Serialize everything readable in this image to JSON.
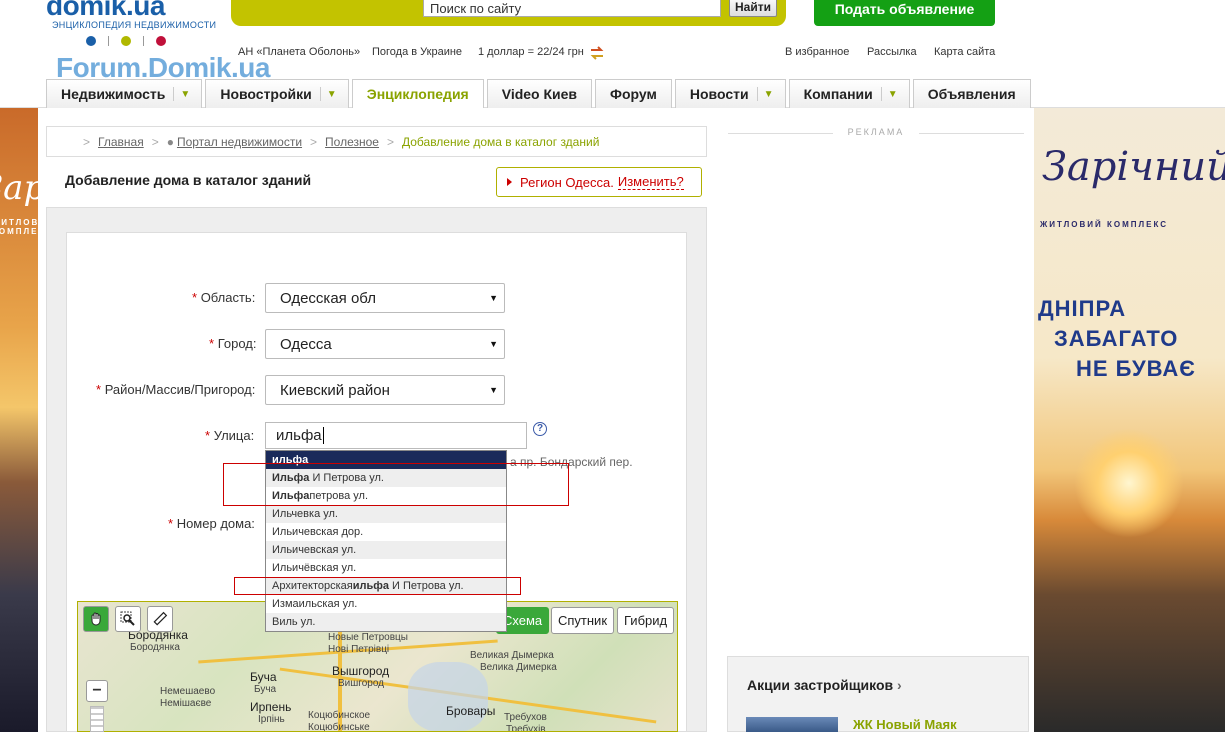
{
  "header": {
    "logo": "domik.ua",
    "logo_sub": "ЭНЦИКЛОПЕДИЯ НЕДВИЖИМОСТИ",
    "watermark": "Forum.Domik.ua",
    "search_placeholder": "Поиск по сайту",
    "search_button": "Найти",
    "post_button": "Подать объявление",
    "info_links": [
      "АН «Планета Оболонь»",
      "Погода в Украине",
      "1 доллар = 22/24 грн"
    ],
    "top_links": [
      "В избранное",
      "Рассылка",
      "Карта сайта"
    ],
    "dot_colors": [
      "#1a5fa8",
      "#b0b800",
      "#c0103a"
    ]
  },
  "nav": {
    "items": [
      {
        "label": "Недвижимость",
        "arrow": true
      },
      {
        "label": "Новостройки",
        "arrow": true
      },
      {
        "label": "Энциклопедия",
        "arrow": false,
        "active": true
      },
      {
        "label": "Video Киев",
        "arrow": false
      },
      {
        "label": "Форум",
        "arrow": false
      },
      {
        "label": "Новости",
        "arrow": true
      },
      {
        "label": "Компании",
        "arrow": true
      },
      {
        "label": "Объявления",
        "arrow": false
      }
    ]
  },
  "breadcrumb": {
    "items": [
      "Главная",
      "Портал недвижимости",
      "Полезное"
    ],
    "current": "Добавление дома в каталог зданий"
  },
  "page_title": "Добавление дома в каталог зданий",
  "region": {
    "text": "Регион Одесса.",
    "change": "Изменить?"
  },
  "form": {
    "oblast_label": "Область:",
    "oblast_value": "Одесская обл",
    "city_label": "Город:",
    "city_value": "Одесса",
    "district_label": "Район/Массив/Пригород:",
    "district_value": "Киевский район",
    "street_label": "Улица:",
    "street_value": "ильфа",
    "street_hint": "а пр. Бондарский пер.",
    "house_label": "Номер дома:",
    "required_mark": "*",
    "help_mark": "?"
  },
  "autocomplete": {
    "items": [
      {
        "match": "ильфа",
        "rest": "",
        "style": "first"
      },
      {
        "match": "Ильфа",
        "rest": " И Петрова ул.",
        "style": "alt"
      },
      {
        "match": "Ильфа",
        "rest": "петрова ул.",
        "style": ""
      },
      {
        "match": "",
        "rest": "Ильчевка ул.",
        "style": "alt"
      },
      {
        "match": "",
        "rest": "Ильичевская дор.",
        "style": ""
      },
      {
        "match": "",
        "rest": "Ильичевская ул.",
        "style": "alt"
      },
      {
        "match": "",
        "rest": "Ильичёвская ул.",
        "style": ""
      },
      {
        "prefix": "Архитекторская",
        "match": "ильфа",
        "rest": " И Петрова ул.",
        "style": "alt"
      },
      {
        "match": "",
        "rest": "Измаильская ул.",
        "style": ""
      },
      {
        "match": "",
        "rest": "Виль ул.",
        "style": "alt"
      }
    ]
  },
  "map": {
    "buttons": [
      "Схема",
      "Спутник",
      "Гибрид"
    ],
    "towns": [
      {
        "name": "Бородянка",
        "sub": "Бородянка"
      },
      {
        "name": "Новые Петровцы",
        "sub": "Нові Петрівці"
      },
      {
        "name": "Вышгород",
        "sub": "Вишгород"
      },
      {
        "name": "Великая Дымерка",
        "sub": "Велика Димерка"
      },
      {
        "name": "Буча",
        "sub": "Буча"
      },
      {
        "name": "Немешаево",
        "sub": "Немішаєве"
      },
      {
        "name": "Ирпень",
        "sub": "Ірпінь"
      },
      {
        "name": "Коцюбинское",
        "sub": "Коцюбинське"
      },
      {
        "name": "Бровары",
        "sub": ""
      },
      {
        "name": "Требухов",
        "sub": "Требухів"
      }
    ]
  },
  "sidebar": {
    "ad_label": "РЕКЛАМА",
    "promo_title": "Акции застройщиков",
    "promo_item": "ЖК Новый Маяк"
  },
  "banner_left": {
    "text": "Зарічний",
    "sub": "ЖИТЛОВИЙ КОМПЛЕКС"
  },
  "banner_right": {
    "logo": "Зарічний",
    "sub": "ЖИТЛОВИЙ КОМПЛЕКС",
    "line1": "ДНІПРА",
    "line2": "ЗАБАГАТО",
    "line3": "НЕ БУВАЄ"
  }
}
